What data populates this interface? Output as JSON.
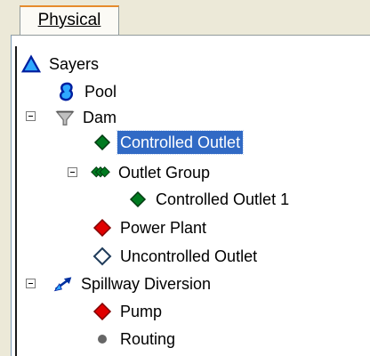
{
  "tabs": [
    {
      "label": "Physical",
      "mnemonic": "P"
    }
  ],
  "tree": {
    "root": {
      "label": "Sayers",
      "icon": "triangle-reservoir-icon"
    },
    "items": [
      {
        "label": "Pool",
        "icon": "pool-icon"
      },
      {
        "label": "Dam",
        "icon": "dam-funnel-icon",
        "expanded": true
      },
      {
        "label": "Controlled Outlet",
        "icon": "green-diamond-icon",
        "selected": true
      },
      {
        "label": "Outlet Group",
        "icon": "green-diamond-group-icon",
        "expanded": true
      },
      {
        "label": "Controlled Outlet 1",
        "icon": "green-diamond-icon"
      },
      {
        "label": "Power Plant",
        "icon": "red-diamond-icon"
      },
      {
        "label": "Uncontrolled Outlet",
        "icon": "outline-diamond-icon"
      },
      {
        "label": "Spillway Diversion",
        "icon": "diversion-arrow-icon",
        "expanded": true
      },
      {
        "label": "Pump",
        "icon": "red-diamond-icon"
      },
      {
        "label": "Routing",
        "icon": "gray-dot-icon"
      }
    ]
  }
}
